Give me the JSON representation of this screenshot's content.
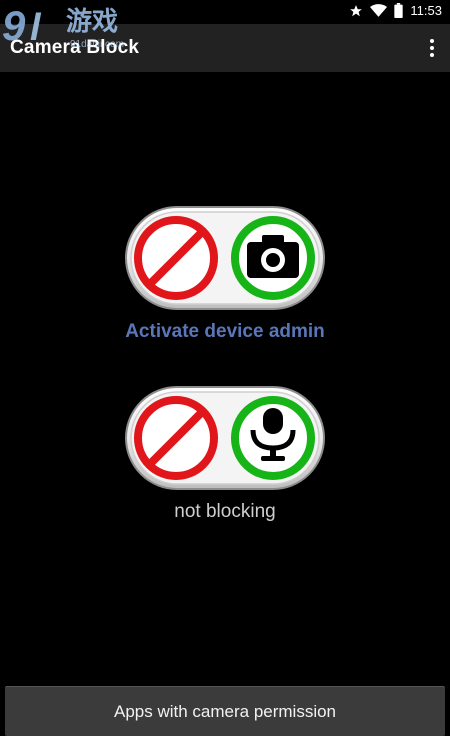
{
  "status_bar": {
    "time": "11:53",
    "icons": [
      "star-icon",
      "wifi-icon",
      "battery-icon"
    ]
  },
  "watermark": {
    "number": "9",
    "title": "游戏",
    "subtitle": "91danji.com"
  },
  "app_bar": {
    "title": "Camera Block",
    "menu_icon": "overflow-menu-icon"
  },
  "camera_toggle": {
    "left_icon": "block-icon",
    "right_icon": "camera-icon",
    "active_color": "#16b416",
    "block_color": "#e0161a"
  },
  "admin_link": {
    "label": "Activate device admin",
    "color": "#5a76b8"
  },
  "mic_toggle": {
    "left_icon": "block-icon",
    "right_icon": "microphone-icon"
  },
  "status": {
    "text": "not blocking"
  },
  "bottom_button": {
    "label": "Apps with camera permission"
  }
}
